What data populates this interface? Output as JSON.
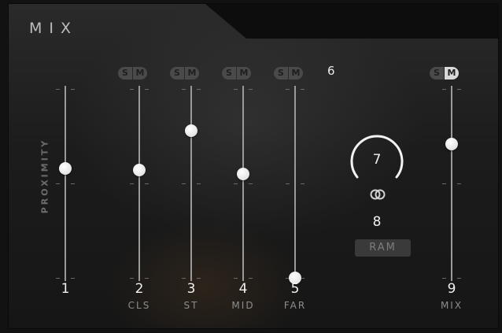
{
  "header": {
    "title": "MIX"
  },
  "proximity": {
    "label": "PROXIMITY"
  },
  "sm": {
    "solo": "S",
    "mute": "M"
  },
  "group_number": "6",
  "channels": [
    {
      "number": "1",
      "label": "",
      "level": 0.58
    },
    {
      "number": "2",
      "label": "CLS",
      "level": 0.57
    },
    {
      "number": "3",
      "label": "ST",
      "level": 0.78
    },
    {
      "number": "4",
      "label": "MID",
      "level": 0.55
    },
    {
      "number": "5",
      "label": "FAR",
      "level": 0.0
    },
    {
      "number": "9",
      "label": "MIX",
      "level": 0.71
    }
  ],
  "knob": {
    "value": "7",
    "level": 0.5
  },
  "link": {
    "icon": "link-rings-icon"
  },
  "ram": {
    "number": "8",
    "label": "RAM"
  },
  "colors": {
    "accent": "#d9d9d9",
    "background": "#1c1c1c"
  }
}
